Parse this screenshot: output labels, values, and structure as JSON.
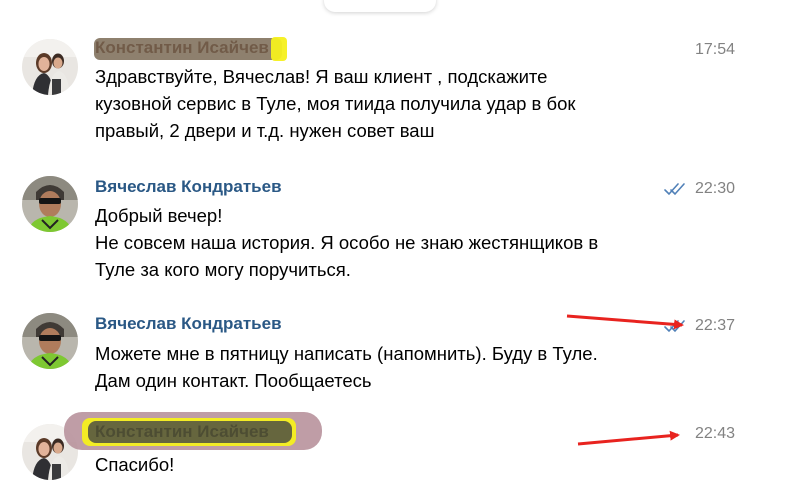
{
  "messages": [
    {
      "author": "Константин Исайчев",
      "time": "17:54",
      "lines": [
        "Здравствуйте, Вячеслав! Я ваш клиент , подскажите",
        "кузовной сервис в Туле, моя тиида  получила удар в бок",
        "правый, 2 двери и т.д. нужен совет ваш"
      ]
    },
    {
      "author": "Вячеслав Кондратьев",
      "time": "22:30",
      "lines": [
        "Добрый вечер!",
        "Не совсем наша история. Я особо не знаю жестянщиков в",
        "Туле за кого могу поручиться."
      ]
    },
    {
      "author": "Вячеслав Кондратьев",
      "time": "22:37",
      "lines": [
        "Можете мне в пятницу написать (напомнить). Буду в Туле.",
        "Дам один контакт. Пообщаетесь"
      ]
    },
    {
      "author": "Константин Исайчев",
      "time": "22:43",
      "lines": [
        "Спасибо!"
      ]
    }
  ],
  "colors": {
    "author_link": "#2a5885",
    "time": "#828282",
    "read_check": "#5181b8",
    "annotation_arrow": "#e8231f"
  },
  "icons": [
    "avatar-konstantin",
    "avatar-vyacheslav",
    "double-check-icon",
    "annotation-arrow"
  ]
}
